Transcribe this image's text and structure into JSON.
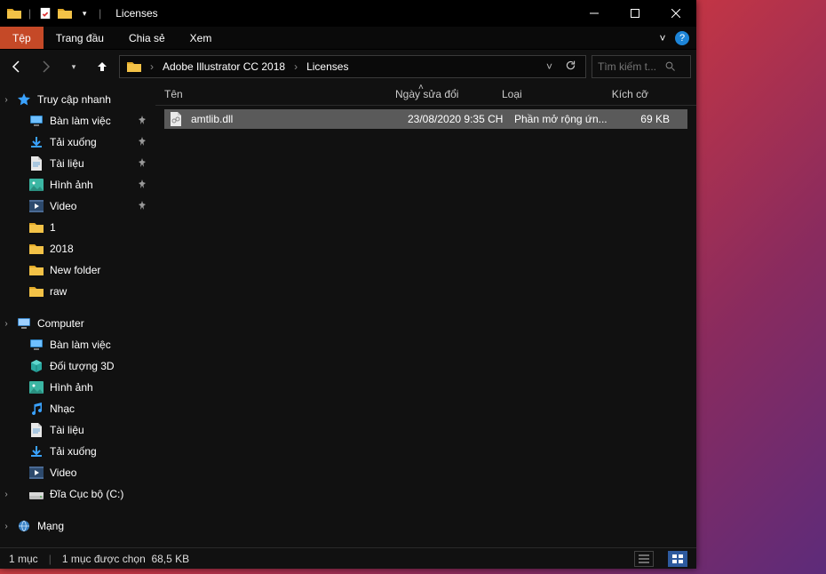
{
  "window": {
    "title": "Licenses"
  },
  "ribbon": {
    "tabs": [
      "Tệp",
      "Trang đầu",
      "Chia sẻ",
      "Xem"
    ],
    "active": 0
  },
  "breadcrumb": {
    "items": [
      "Adobe Illustrator CC 2018",
      "Licenses"
    ]
  },
  "search": {
    "placeholder": "Tìm kiếm t..."
  },
  "sidebar": {
    "quick": {
      "label": "Truy cập nhanh",
      "items": [
        {
          "label": "Bàn làm việc",
          "pinned": true,
          "icon": "desktop"
        },
        {
          "label": "Tải xuống",
          "pinned": true,
          "icon": "download"
        },
        {
          "label": "Tài liệu",
          "pinned": true,
          "icon": "document"
        },
        {
          "label": "Hình ảnh",
          "pinned": true,
          "icon": "picture"
        },
        {
          "label": "Video",
          "pinned": true,
          "icon": "video"
        },
        {
          "label": "1",
          "pinned": false,
          "icon": "folder"
        },
        {
          "label": "2018",
          "pinned": false,
          "icon": "folder"
        },
        {
          "label": "New folder",
          "pinned": false,
          "icon": "folder"
        },
        {
          "label": "raw",
          "pinned": false,
          "icon": "folder"
        }
      ]
    },
    "computer": {
      "label": "Computer",
      "items": [
        {
          "label": "Bàn làm việc",
          "icon": "desktop"
        },
        {
          "label": "Đối tượng 3D",
          "icon": "object3d"
        },
        {
          "label": "Hình ảnh",
          "icon": "picture"
        },
        {
          "label": "Nhạc",
          "icon": "music"
        },
        {
          "label": "Tài liệu",
          "icon": "document"
        },
        {
          "label": "Tải xuống",
          "icon": "download"
        },
        {
          "label": "Video",
          "icon": "video"
        },
        {
          "label": "Đĩa Cục bộ (C:)",
          "icon": "drive"
        }
      ]
    },
    "network": {
      "label": "Mạng"
    }
  },
  "columns": {
    "name": "Tên",
    "date": "Ngày sửa đổi",
    "type": "Loại",
    "size": "Kích cỡ",
    "sorted": "name",
    "direction": "asc"
  },
  "files": [
    {
      "name": "amtlib.dll",
      "date": "23/08/2020 9:35 CH",
      "type": "Phần mở rộng ứn...",
      "size": "69 KB",
      "selected": true
    }
  ],
  "status": {
    "count": "1 mục",
    "selection": "1 mục được chọn",
    "size": "68,5 KB"
  },
  "colors": {
    "accent": "#c54927"
  }
}
